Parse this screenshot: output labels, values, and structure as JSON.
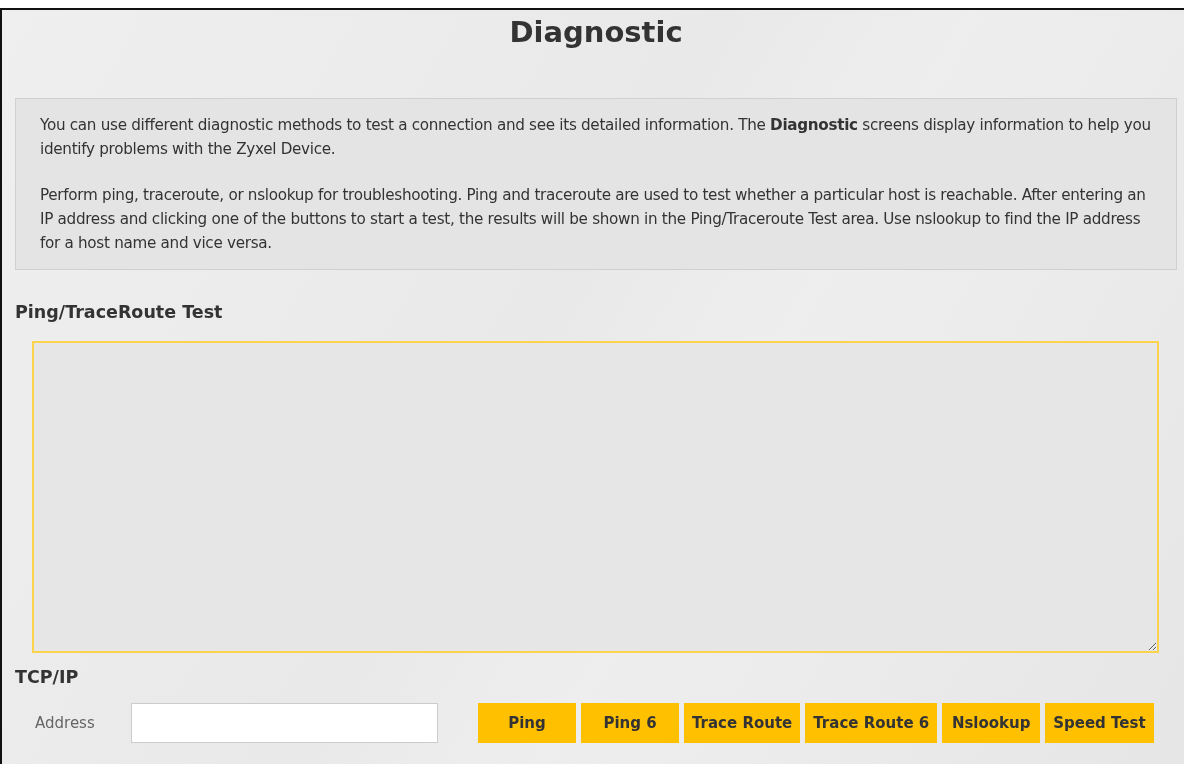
{
  "title": "Diagnostic",
  "intro": {
    "paragraphs": [
      "You can use different diagnostic methods to test a connection and see its detailed information. The **Diagnostic** screens display information to help you identify problems with the Zyxel Device.",
      "Perform ping, traceroute, or nslookup for troubleshooting. Ping and traceroute are used to test whether a particular host is reachable. After entering an IP address and clicking one of the buttons to start a test, the results will be shown in the Ping/Traceroute Test area. Use nslookup to find the IP address for a host name and vice versa."
    ]
  },
  "ping_test": {
    "heading": "Ping/TraceRoute Test"
  },
  "tcp_ip": {
    "heading": "TCP/IP",
    "address_label": "Address",
    "buttons": [
      "Ping",
      "Ping 6",
      "Trace Route",
      "Trace Route 6",
      "Nslookup",
      "Speed Test"
    ]
  }
}
